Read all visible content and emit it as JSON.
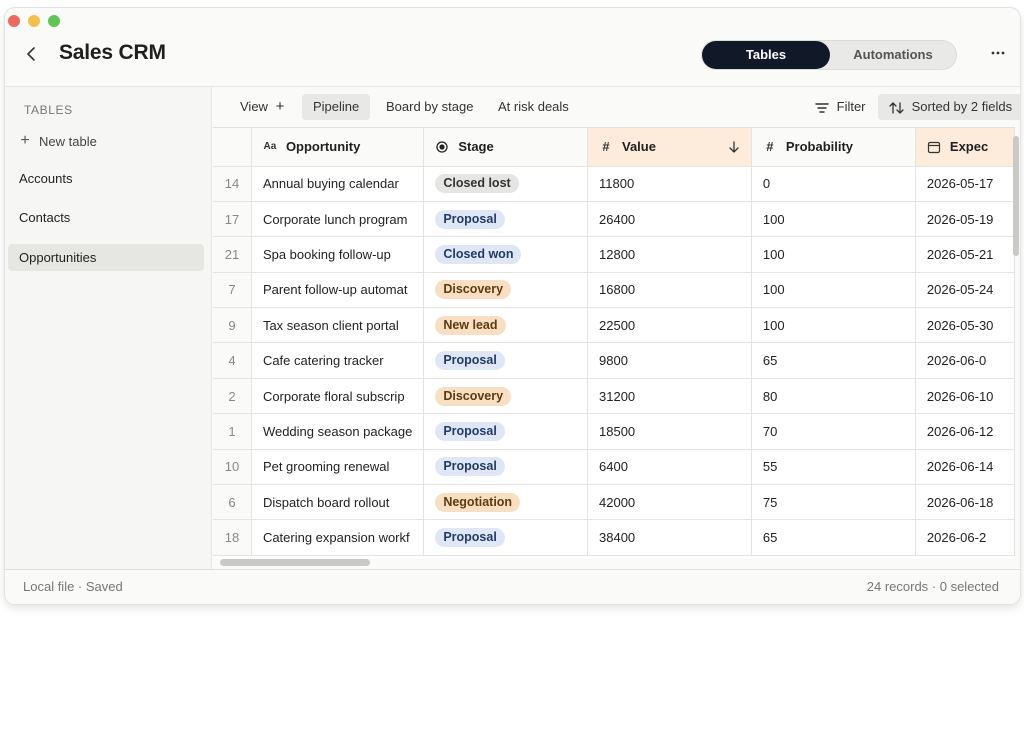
{
  "app": {
    "title": "Sales CRM"
  },
  "header": {
    "segments": [
      {
        "label": "Tables",
        "active": true
      },
      {
        "label": "Automations",
        "active": false
      }
    ],
    "more_icon": "more-horizontal-icon"
  },
  "sidebar": {
    "heading": "TABLES",
    "new_table_label": "New table",
    "items": [
      {
        "label": "Accounts",
        "active": false
      },
      {
        "label": "Contacts",
        "active": false
      },
      {
        "label": "Opportunities",
        "active": true
      }
    ]
  },
  "toolbar": {
    "view_label": "View",
    "views": [
      "Pipeline",
      "Board by stage",
      "At risk deals"
    ],
    "active_view": "Pipeline",
    "filter_label": "Filter",
    "sort_label": "Sorted by 2 fields"
  },
  "table": {
    "columns": [
      {
        "label": "Opportunity",
        "icon": "text-field-icon"
      },
      {
        "label": "Stage",
        "icon": "single-select-icon"
      },
      {
        "label": "Value",
        "icon": "number-icon",
        "sorted": "descending"
      },
      {
        "label": "Probability",
        "icon": "number-icon"
      },
      {
        "label": "Expec",
        "icon": "calendar-icon",
        "sorted": "ascending"
      }
    ],
    "rows": [
      {
        "id": "14",
        "opportunity": "Annual buying calendar",
        "stage": "Closed lost",
        "value": "11800",
        "probability": "0",
        "expected": "2026-05-17"
      },
      {
        "id": "17",
        "opportunity": "Corporate lunch program",
        "stage": "Proposal",
        "value": "26400",
        "probability": "100",
        "expected": "2026-05-19"
      },
      {
        "id": "21",
        "opportunity": "Spa booking follow-up",
        "stage": "Closed won",
        "value": "12800",
        "probability": "100",
        "expected": "2026-05-21"
      },
      {
        "id": "7",
        "opportunity": "Parent follow-up automat",
        "stage": "Discovery",
        "value": "16800",
        "probability": "100",
        "expected": "2026-05-24"
      },
      {
        "id": "9",
        "opportunity": "Tax season client portal",
        "stage": "New lead",
        "value": "22500",
        "probability": "100",
        "expected": "2026-05-30"
      },
      {
        "id": "4",
        "opportunity": "Cafe catering tracker",
        "stage": "Proposal",
        "value": "9800",
        "probability": "65",
        "expected": "2026-06-0"
      },
      {
        "id": "2",
        "opportunity": "Corporate floral subscrip",
        "stage": "Discovery",
        "value": "31200",
        "probability": "80",
        "expected": "2026-06-10"
      },
      {
        "id": "1",
        "opportunity": "Wedding season package",
        "stage": "Proposal",
        "value": "18500",
        "probability": "70",
        "expected": "2026-06-12"
      },
      {
        "id": "10",
        "opportunity": "Pet grooming renewal",
        "stage": "Proposal",
        "value": "6400",
        "probability": "55",
        "expected": "2026-06-14"
      },
      {
        "id": "6",
        "opportunity": "Dispatch board rollout",
        "stage": "Negotiation",
        "value": "42000",
        "probability": "75",
        "expected": "2026-06-18"
      },
      {
        "id": "18",
        "opportunity": "Catering expansion workf",
        "stage": "Proposal",
        "value": "38400",
        "probability": "65",
        "expected": "2026-06-2"
      }
    ]
  },
  "stage_colors": {
    "Closed lost": {
      "bg": "#e5e5e3",
      "fg": "#333333"
    },
    "Proposal": {
      "bg": "#dfe7f7",
      "fg": "#243a63"
    },
    "Closed won": {
      "bg": "#dfe7f7",
      "fg": "#243a63"
    },
    "Discovery": {
      "bg": "#f8dfc2",
      "fg": "#5c3a12"
    },
    "New lead": {
      "bg": "#f8dfc2",
      "fg": "#5c3a12"
    },
    "Negotiation": {
      "bg": "#f8dfc2",
      "fg": "#5c3a12"
    }
  },
  "status": {
    "left": "Local file · Saved",
    "right": "24 records · 0 selected"
  }
}
